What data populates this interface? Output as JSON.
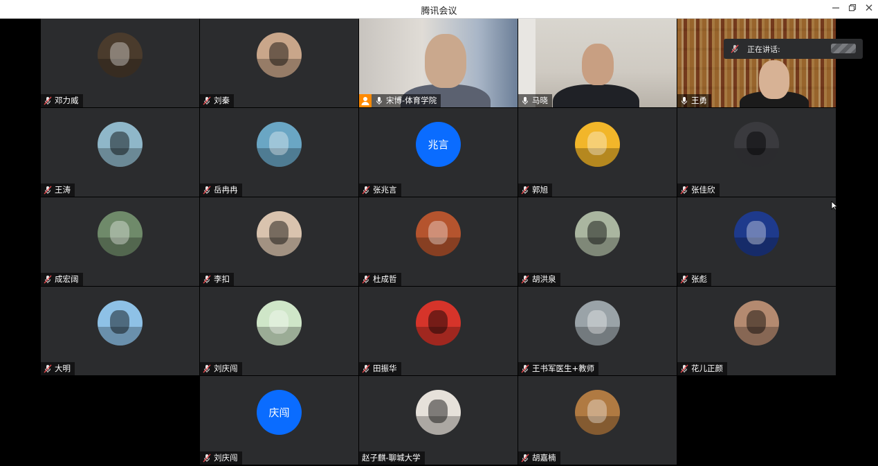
{
  "window": {
    "title": "腾讯会议"
  },
  "speaking": {
    "label": "正在讲话:"
  },
  "participants": [
    {
      "name": "邓力威",
      "avatar": "photo-avatar",
      "color": "#4a3b2c",
      "mic": "muted"
    },
    {
      "name": "刘秦",
      "avatar": "photo-avatar",
      "color": "#c9a68a",
      "mic": "muted"
    },
    {
      "name": "宋博-体育学院",
      "avatar": "video",
      "mic": "on",
      "host": true
    },
    {
      "name": "马晓",
      "avatar": "video",
      "mic": "on"
    },
    {
      "name": "王勇",
      "avatar": "video",
      "mic": "on"
    },
    {
      "name": "王涛",
      "avatar": "photo-avatar",
      "color": "#8fb7c9",
      "mic": "muted"
    },
    {
      "name": "岳冉冉",
      "avatar": "photo-avatar",
      "color": "#6aa6c4",
      "mic": "muted"
    },
    {
      "name": "张兆言",
      "avatar": "text-avatar",
      "text": "兆言",
      "color": "#0a6cff",
      "mic": "muted"
    },
    {
      "name": "郭旭",
      "avatar": "photo-avatar",
      "color": "#f2b62a",
      "mic": "muted"
    },
    {
      "name": "张佳欣",
      "avatar": "photo-avatar",
      "color": "#3a3a3e",
      "mic": "muted"
    },
    {
      "name": "成宏阔",
      "avatar": "photo-avatar",
      "color": "#6f8a6a",
      "mic": "muted"
    },
    {
      "name": "李扣",
      "avatar": "photo-avatar",
      "color": "#d9c3ae",
      "mic": "muted"
    },
    {
      "name": "杜成哲",
      "avatar": "photo-avatar",
      "color": "#b5542e",
      "mic": "muted"
    },
    {
      "name": "胡洪泉",
      "avatar": "photo-avatar",
      "color": "#aab6a0",
      "mic": "muted"
    },
    {
      "name": "张彪",
      "avatar": "photo-avatar",
      "color": "#1e3a8c",
      "mic": "muted"
    },
    {
      "name": "大明",
      "avatar": "photo-avatar",
      "color": "#8ec1e6",
      "mic": "muted"
    },
    {
      "name": "刘庆闯",
      "avatar": "photo-avatar",
      "color": "#cfe6c8",
      "mic": "muted"
    },
    {
      "name": "田振华",
      "avatar": "photo-avatar",
      "color": "#d6342a",
      "mic": "muted"
    },
    {
      "name": "王书军医生+教师",
      "avatar": "photo-avatar",
      "color": "#9aa3a8",
      "mic": "muted"
    },
    {
      "name": "花儿正颜",
      "avatar": "photo-avatar",
      "color": "#b48a70",
      "mic": "muted"
    },
    {
      "name": "刘庆闯",
      "avatar": "text-avatar",
      "text": "庆闯",
      "color": "#0a6cff",
      "mic": "muted"
    },
    {
      "name": "赵子麒-聊城大学",
      "avatar": "photo-avatar",
      "color": "#e6e1da",
      "mic": "none"
    },
    {
      "name": "胡嘉楠",
      "avatar": "photo-avatar",
      "color": "#b07a42",
      "mic": "muted"
    }
  ]
}
